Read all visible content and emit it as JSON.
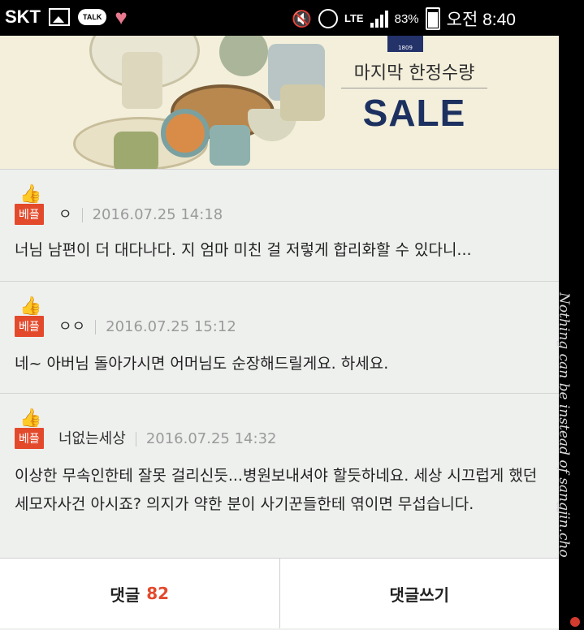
{
  "status_bar": {
    "carrier": "SKT",
    "talk_icon_label": "TALK",
    "network": "LTE",
    "battery": "83%",
    "time": "오전 8:40",
    "icons": [
      "gallery-icon",
      "kakaotalk-icon",
      "heart-icon",
      "mute-icon",
      "alarm-icon",
      "signal-icon",
      "battery-icon"
    ]
  },
  "banner": {
    "subtitle": "마지막 한정수량",
    "sale": "SALE",
    "brand_year": "1809"
  },
  "comments": [
    {
      "badge": "베플",
      "author": "ㅇ",
      "date": "2016.07.25 14:18",
      "text": "너님 남편이 더 대다나다. 지 엄마 미친 걸 저렇게 합리화할 수 있다니..."
    },
    {
      "badge": "베플",
      "author": "ㅇㅇ",
      "date": "2016.07.25 15:12",
      "text": "네~ 아버님 돌아가시면 어머님도 순장해드릴게요. 하세요."
    },
    {
      "badge": "베플",
      "author": "너없는세상",
      "date": "2016.07.25 14:32",
      "text": "이상한 무속인한테 잘못 걸리신듯...병원보내셔야 할듯하네요. 세상 시끄럽게 했던 세모자사건 아시죠? 의지가 약한 분이 사기꾼들한테 엮이면 무섭습니다."
    }
  ],
  "bottom_bar": {
    "comments_label": "댓글",
    "comments_count": "82",
    "write_label": "댓글쓰기"
  },
  "watermark": "Nothing can be instead of sangjin.cho",
  "colors": {
    "accent": "#e34a2c",
    "sale_blue": "#1d3160",
    "background": "#eef0ee"
  }
}
